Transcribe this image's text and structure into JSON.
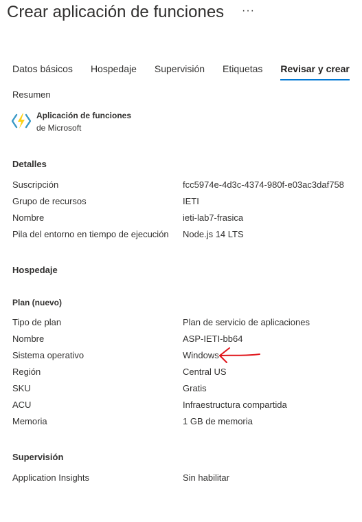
{
  "header": {
    "title": "Crear aplicación de funciones",
    "more": "···"
  },
  "tabs": [
    {
      "label": "Datos básicos",
      "active": false
    },
    {
      "label": "Hospedaje",
      "active": false
    },
    {
      "label": "Supervisión",
      "active": false
    },
    {
      "label": "Etiquetas",
      "active": false
    },
    {
      "label": "Revisar y crear",
      "active": true
    }
  ],
  "summary": {
    "heading": "Resumen",
    "product_name": "Aplicación de funciones",
    "publisher": "de Microsoft",
    "icon": "function-app-lightning-icon"
  },
  "details": {
    "heading": "Detalles",
    "rows": [
      {
        "label": "Suscripción",
        "value": "fcc5974e-4d3c-4374-980f-e03ac3daf758"
      },
      {
        "label": "Grupo de recursos",
        "value": "IETI"
      },
      {
        "label": "Nombre",
        "value": "ieti-lab7-frasica"
      },
      {
        "label": "Pila del entorno en tiempo de ejecución",
        "value": "Node.js 14 LTS"
      }
    ]
  },
  "hosting": {
    "heading": "Hospedaje",
    "plan_heading": "Plan (nuevo)",
    "rows": [
      {
        "label": "Tipo de plan",
        "value": "Plan de servicio de aplicaciones"
      },
      {
        "label": "Nombre",
        "value": "ASP-IETI-bb64"
      },
      {
        "label": "Sistema operativo",
        "value": "Windows"
      },
      {
        "label": "Región",
        "value": "Central US"
      },
      {
        "label": "SKU",
        "value": "Gratis"
      },
      {
        "label": "ACU",
        "value": "Infraestructura compartida"
      },
      {
        "label": "Memoria",
        "value": "1 GB de memoria"
      }
    ]
  },
  "monitoring": {
    "heading": "Supervisión",
    "rows": [
      {
        "label": "Application Insights",
        "value": "Sin habilitar"
      }
    ]
  },
  "annotation": {
    "color": "#e0141a"
  },
  "colors": {
    "accent": "#0078d4",
    "text": "#323130"
  }
}
